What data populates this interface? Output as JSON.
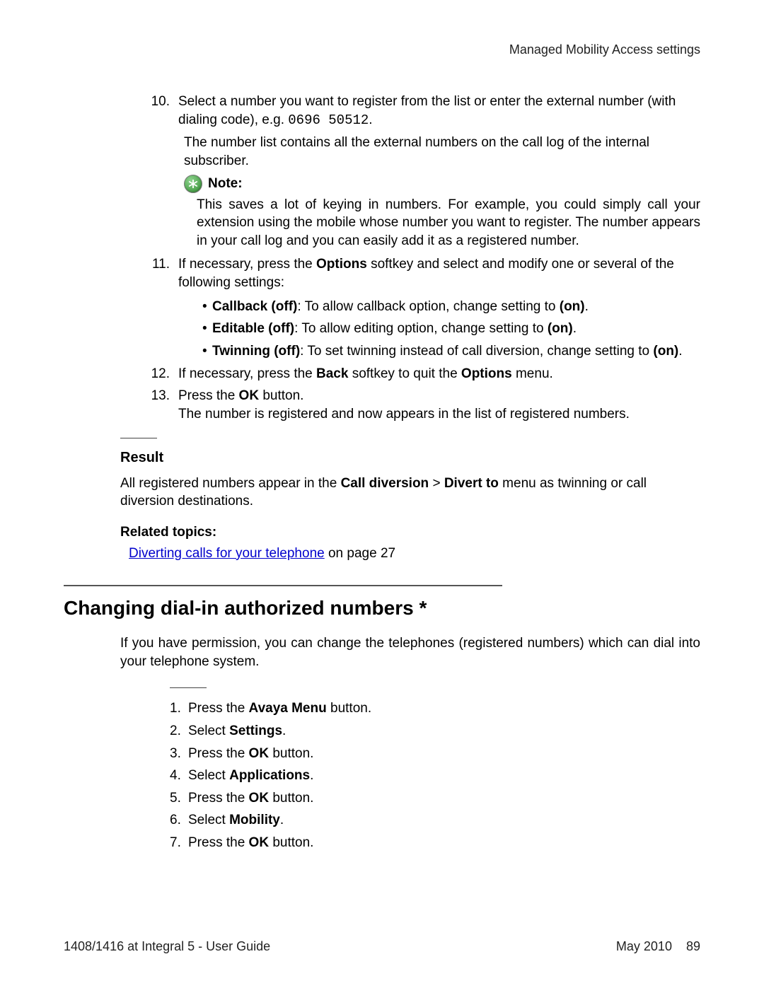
{
  "header": {
    "right": "Managed Mobility Access settings"
  },
  "steps1": {
    "s10": {
      "num": "10.",
      "text_a": "Select a number you want to register from the list or enter the external number (with dialing code), e.g. ",
      "code": "0696 50512",
      "text_b": ".",
      "para2": "The number list contains all the external numbers on the call log of the internal subscriber.",
      "note_label": "Note:",
      "note_text": "This saves a lot of keying in numbers. For example, you could simply call your extension using the mobile whose number you want to register. The number appears in your call log and you can easily add it as a registered number."
    },
    "s11": {
      "num": "11.",
      "text_a": "If necessary, press the ",
      "b1": "Options",
      "text_b": " softkey and select and modify one or several of the following settings:",
      "opts": {
        "o1": {
          "b": "Callback (off)",
          "t": ": To allow callback option, change setting to ",
          "on": "(on)",
          "end": "."
        },
        "o2": {
          "b": "Editable (off)",
          "t": ": To allow editing option, change setting to ",
          "on": "(on)",
          "end": "."
        },
        "o3": {
          "b": "Twinning (off)",
          "t": ": To set twinning instead of call diversion, change setting to ",
          "on": "(on)",
          "end": "."
        }
      }
    },
    "s12": {
      "num": "12.",
      "a": "If necessary, press the ",
      "b1": "Back",
      "mid": " softkey to quit the ",
      "b2": "Options",
      "end": " menu."
    },
    "s13": {
      "num": "13.",
      "a": "Press the ",
      "b1": "OK",
      "mid": " button.",
      "line2": "The number is registered and now appears in the list of registered numbers."
    }
  },
  "result": {
    "heading": "Result",
    "p_a": "All registered numbers appear in the ",
    "b1": "Call diversion",
    "gt": " > ",
    "b2": "Divert to",
    "p_b": " menu as twinning or call diversion destinations."
  },
  "related": {
    "heading": "Related topics:",
    "link": "Diverting calls for your telephone",
    "rest": " on page 27"
  },
  "h2": "Changing dial-in authorized numbers *",
  "intro": "If you have permission, you can change the telephones (registered numbers) which can dial into your telephone system.",
  "steps2": {
    "s1": {
      "num": "1.",
      "a": "Press the ",
      "b": "Avaya Menu",
      "c": " button."
    },
    "s2": {
      "num": "2.",
      "a": "Select ",
      "b": "Settings",
      "c": "."
    },
    "s3": {
      "num": "3.",
      "a": "Press the ",
      "b": "OK",
      "c": " button."
    },
    "s4": {
      "num": "4.",
      "a": "Select ",
      "b": "Applications",
      "c": "."
    },
    "s5": {
      "num": "5.",
      "a": "Press the ",
      "b": "OK",
      "c": " button."
    },
    "s6": {
      "num": "6.",
      "a": "Select ",
      "b": "Mobility",
      "c": "."
    },
    "s7": {
      "num": "7.",
      "a": "Press the ",
      "b": "OK",
      "c": " button."
    }
  },
  "footer": {
    "left": "1408/1416 at Integral 5 - User Guide",
    "date": "May 2010",
    "page": "89"
  }
}
